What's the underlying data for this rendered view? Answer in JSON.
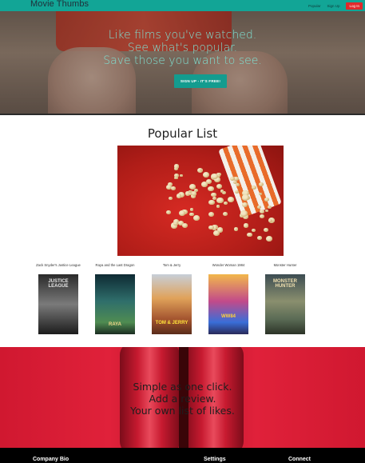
{
  "nav": {
    "brand": "Movie Thumbs",
    "links": [
      "Popular",
      "Sign Up",
      "Log In"
    ]
  },
  "hero": {
    "lines": [
      "Like films you've watched.",
      "See what's popular.",
      "Save those you want to see."
    ],
    "signup_label": "SIGN UP - IT'S FREE!"
  },
  "popular": {
    "title": "Popular List",
    "movies": [
      {
        "title": "Zack Snyder's Justice League",
        "poster_text": "JUSTICE LEAGUE",
        "color": "#6b6b6b"
      },
      {
        "title": "Raya and the Last Dragon",
        "poster_text": "RAYA",
        "color": "#2f6e6b"
      },
      {
        "title": "Tom & Jerry",
        "poster_text": "TOM & JERRY",
        "color": "#c98b3e"
      },
      {
        "title": "Wonder Woman 1984",
        "poster_text": "WW84",
        "color": "#b23a8e"
      },
      {
        "title": "Monster Hunter",
        "poster_text": "MONSTER HUNTER",
        "color": "#5a6b55"
      }
    ]
  },
  "seats": {
    "lines": [
      "Simple as one click.",
      "Add a review.",
      "Your own list of likes."
    ]
  },
  "footer": {
    "links": [
      "Company Bio",
      "Settings",
      "Connect"
    ]
  },
  "colors": {
    "accent": "#12a596",
    "hero_text": "#7fe0d2",
    "login": "#e0292b"
  }
}
